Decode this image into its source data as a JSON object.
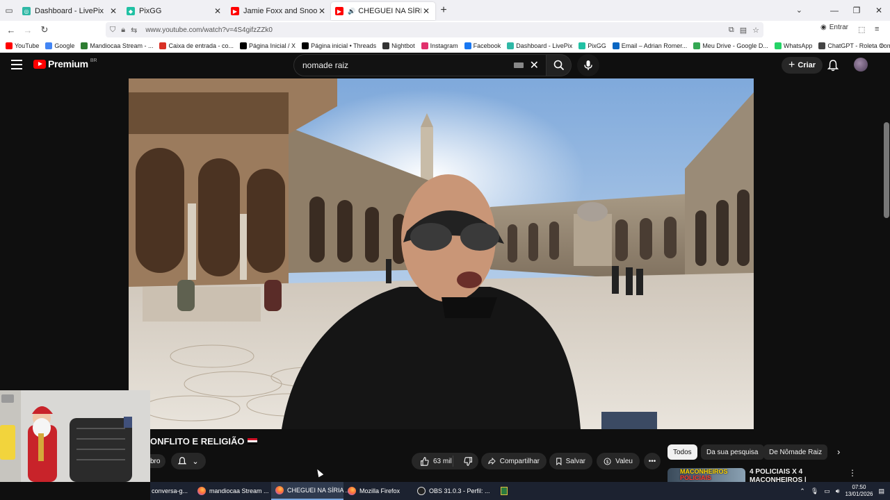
{
  "browser": {
    "tabs": [
      {
        "title": "Dashboard - LivePix",
        "favicon_color": "#2fb8a6"
      },
      {
        "title": "PixGG",
        "favicon_color": "#21c1a4"
      },
      {
        "title": "Jamie Foxx and Snoop Dogg - I",
        "favicon_color": "#ff0000"
      },
      {
        "title": "CHEGUEI NA SÍRIA PAÍS DE",
        "favicon_color": "#ff0000"
      }
    ],
    "new_tab": "+",
    "url": "www.youtube.com/watch?v=4S4gifzZZk0",
    "login_label": "Entrar",
    "bookmarks": [
      {
        "label": "YouTube",
        "color": "#ff0000"
      },
      {
        "label": "Google",
        "color": "#4285f4"
      },
      {
        "label": "Mandiocaa Stream - ...",
        "color": "#2e7d32"
      },
      {
        "label": "Caixa de entrada - co...",
        "color": "#d93025"
      },
      {
        "label": "Página Inicial / X",
        "color": "#000000"
      },
      {
        "label": "Página inicial • Threads",
        "color": "#000000"
      },
      {
        "label": "Nightbot",
        "color": "#333333"
      },
      {
        "label": "Instagram",
        "color": "#e1306c"
      },
      {
        "label": "Facebook",
        "color": "#1877f2"
      },
      {
        "label": "Dashboard - LivePix",
        "color": "#2fb8a6"
      },
      {
        "label": "PixGG",
        "color": "#21c1a4"
      },
      {
        "label": "Email – Adrian Romer...",
        "color": "#0a66c2"
      },
      {
        "label": "Meu Drive - Google D...",
        "color": "#34a853"
      },
      {
        "label": "WhatsApp",
        "color": "#25d366"
      },
      {
        "label": "ChatGPT - Roleta Com...",
        "color": "#444444"
      }
    ]
  },
  "youtube": {
    "logo_text": "Premium",
    "country_code": "BR",
    "search_value": "nomade raiz",
    "create_label": "Criar",
    "video_title": "ONFLITO E RELIGIÃO",
    "subscribe_partial": "bro",
    "likes": "63 mil",
    "share_label": "Compartilhar",
    "save_label": "Salvar",
    "thanks_label": "Valeu",
    "chips": [
      "Todos",
      "Da sua pesquisa",
      "De Nômade Raiz"
    ],
    "side_video": {
      "thumb_text_1": "MACONHEIROS",
      "thumb_text_2": "POLICIAIS",
      "title_1": "4 POLICIAIS X 4",
      "title_2": "MACONHEIROS |"
    }
  },
  "taskbar": {
    "items": [
      {
        "label": "conversa-g...",
        "icon": "window"
      },
      {
        "label": "mandiocaa Stream ...",
        "icon": "firefox"
      },
      {
        "label": "CHEGUEI NA SÍRIA ...",
        "icon": "firefox"
      },
      {
        "label": "Mozilla Firefox",
        "icon": "firefox"
      },
      {
        "label": "OBS 31.0.3 - Perfil: ...",
        "icon": "obs"
      }
    ],
    "time": "07:50",
    "date": "13/01/2026"
  }
}
